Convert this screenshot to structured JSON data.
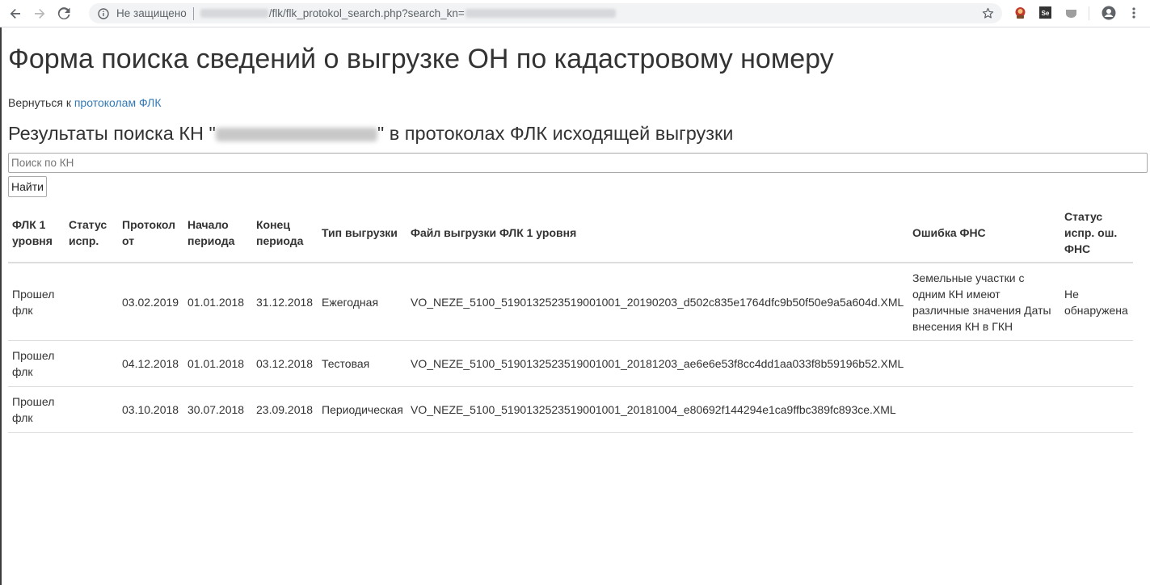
{
  "browser": {
    "security_label": "Не защищено",
    "url_path": "/flk/flk_protokol_search.php?search_kn=",
    "icons": [
      "back-arrow-icon",
      "forward-arrow-icon",
      "reload-icon",
      "info-icon",
      "star-icon",
      "extension-icon",
      "selenium-icon",
      "extension-icon",
      "profile-icon",
      "menu-icon"
    ]
  },
  "page": {
    "title": "Форма поиска сведений о выгрузке ОН по кадастровому номеру",
    "back_prefix": "Вернуться к ",
    "back_link": "протоколам ФЛК",
    "results_prefix": "Результаты поиска КН \"",
    "results_kn": "51:01:0000000:139",
    "results_suffix": "\" в протоколах ФЛК исходящей выгрузки",
    "search_placeholder": "Поиск по КН",
    "find_button": "Найти"
  },
  "table": {
    "headers": [
      "ФЛК 1 уровня",
      "Статус испр.",
      "Протокол от",
      "Начало периода",
      "Конец периода",
      "Тип выгрузки",
      "Файл выгрузки ФЛК 1 уровня",
      "Ошибка ФНС",
      "Статус испр. ош. ФНС"
    ],
    "rows": [
      [
        "Прошел флк",
        "",
        "03.02.2019",
        "01.01.2018",
        "31.12.2018",
        "Ежегодная",
        "VO_NEZE_5100_5190132523519001001_20190203_d502c835e1764dfc9b50f50e9a5a604d.XML",
        "Земельные участки с одним КН имеют различные значения Даты внесения КН в ГКН",
        "Не обнаружена"
      ],
      [
        "Прошел флк",
        "",
        "04.12.2018",
        "01.01.2018",
        "03.12.2018",
        "Тестовая",
        "VO_NEZE_5100_5190132523519001001_20181203_ae6e6e53f8cc4dd1aa033f8b59196b52.XML",
        "",
        ""
      ],
      [
        "Прошел флк",
        "",
        "03.10.2018",
        "30.07.2018",
        "23.09.2018",
        "Периодическая",
        "VO_NEZE_5100_5190132523519001001_20181004_e80692f144294e1ca9ffbc389fc893ce.XML",
        "",
        ""
      ]
    ]
  },
  "colors": {
    "link": "#337ab7",
    "text": "#333333",
    "border": "#dddddd"
  }
}
